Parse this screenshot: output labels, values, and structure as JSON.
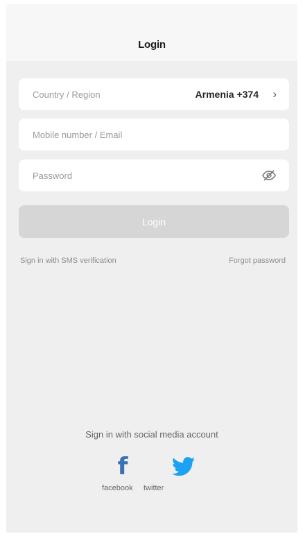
{
  "header": {
    "title": "Login"
  },
  "form": {
    "country_label": "Country / Region",
    "country_value": "Armenia +374",
    "account_placeholder": "Mobile number / Email",
    "password_placeholder": "Password",
    "login_button": "Login"
  },
  "links": {
    "sms": "Sign in with SMS verification",
    "forgot": "Forgot password"
  },
  "social": {
    "title": "Sign in with social media account",
    "facebook_label": "facebook",
    "twitter_label": "twitter"
  },
  "icons": {
    "chevron": "chevron-right-icon",
    "eye": "eye-hidden-icon",
    "facebook": "facebook-icon",
    "twitter": "twitter-icon"
  },
  "colors": {
    "background": "#efefef",
    "button_disabled": "#d6d6d6",
    "facebook": "#3b6fb6",
    "twitter": "#1da1f2"
  }
}
